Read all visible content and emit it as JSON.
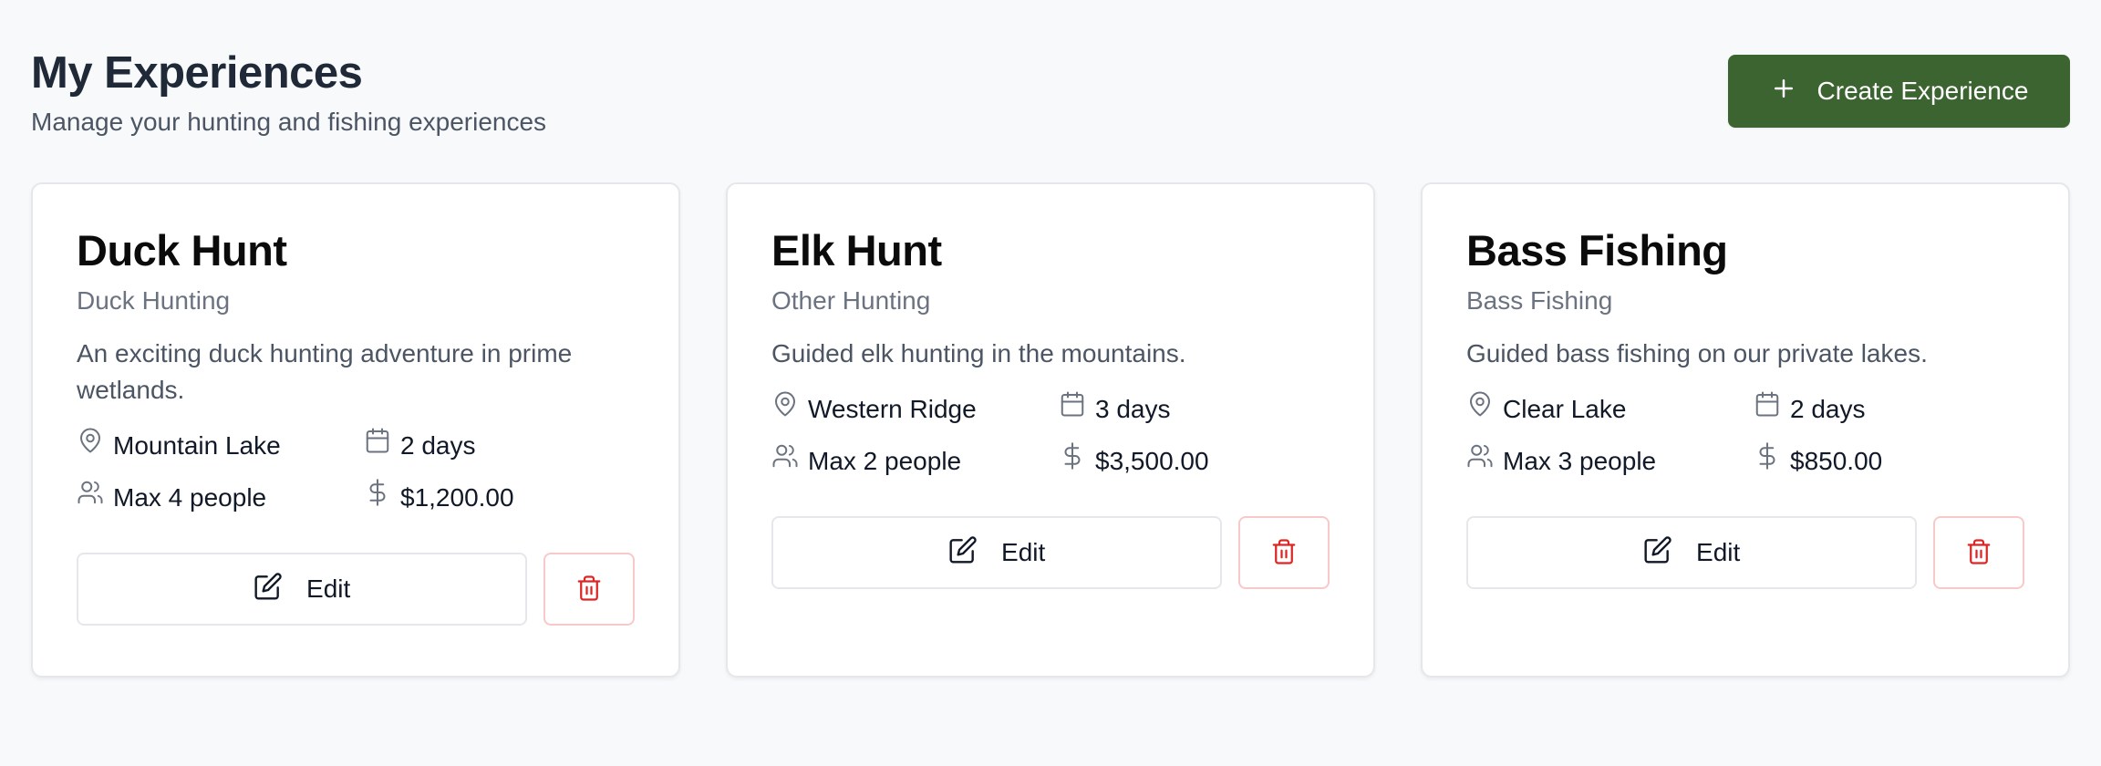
{
  "header": {
    "title": "My Experiences",
    "subtitle": "Manage your hunting and fishing experiences",
    "create_label": "Create Experience"
  },
  "colors": {
    "primary": "#3c6431",
    "danger": "#dc2626",
    "muted": "#6b7280"
  },
  "cards": [
    {
      "title": "Duck Hunt",
      "category": "Duck Hunting",
      "description": "An exciting duck hunting adventure in prime wetlands.",
      "location": "Mountain Lake",
      "duration": "2 days",
      "capacity": "Max 4 people",
      "price": "$1,200.00",
      "edit_label": "Edit"
    },
    {
      "title": "Elk Hunt",
      "category": "Other Hunting",
      "description": "Guided elk hunting in the mountains.",
      "location": "Western Ridge",
      "duration": "3 days",
      "capacity": "Max 2 people",
      "price": "$3,500.00",
      "edit_label": "Edit"
    },
    {
      "title": "Bass Fishing",
      "category": "Bass Fishing",
      "description": "Guided bass fishing on our private lakes.",
      "location": "Clear Lake",
      "duration": "2 days",
      "capacity": "Max 3 people",
      "price": "$850.00",
      "edit_label": "Edit"
    }
  ],
  "icons": {
    "create": "plus-icon",
    "location": "map-pin-icon",
    "duration": "calendar-icon",
    "capacity": "users-icon",
    "price": "dollar-icon",
    "edit": "edit-icon",
    "delete": "trash-icon"
  }
}
